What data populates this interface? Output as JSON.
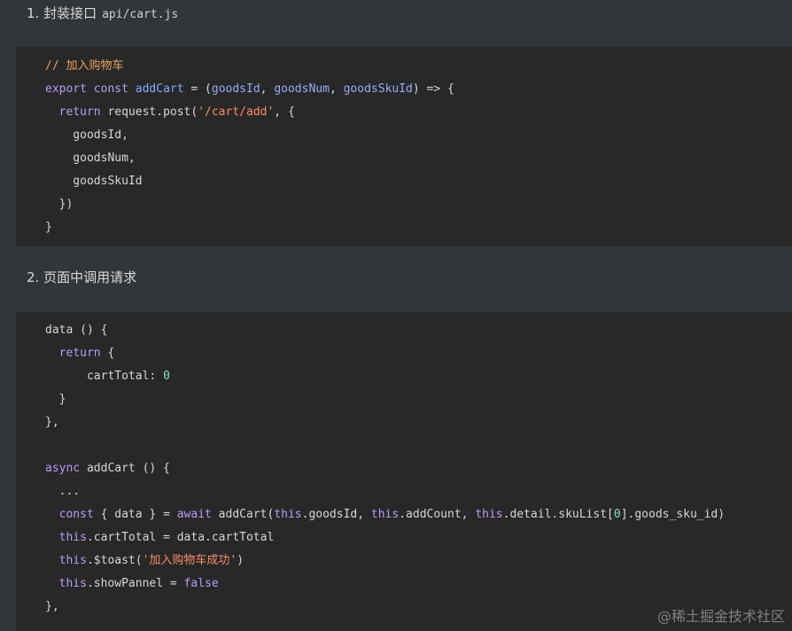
{
  "heading1": {
    "text": "1. 封装接口",
    "code": "api/cart.js"
  },
  "heading2": {
    "text": "2. 页面中调用请求"
  },
  "block1": {
    "lines": [
      {
        "text": "// 加入购物车"
      },
      {
        "text": "export const addCart = (goodsId, goodsNum, goodsSkuId) => {"
      },
      {
        "text": "  return request.post('/cart/add', {"
      },
      {
        "text": "    goodsId,"
      },
      {
        "text": "    goodsNum,"
      },
      {
        "text": "    goodsSkuId"
      },
      {
        "text": "  })"
      },
      {
        "text": "}"
      }
    ]
  },
  "block2": {
    "lines": [
      {
        "text": "data () {"
      },
      {
        "text": "  return {"
      },
      {
        "text": "      cartTotal: 0"
      },
      {
        "text": "  }"
      },
      {
        "text": "},"
      },
      {
        "text": ""
      },
      {
        "text": "async addCart () {"
      },
      {
        "text": "  ..."
      },
      {
        "text": "  const { data } = await addCart(this.goodsId, this.addCount, this.detail.skuList[0].goods_sku_id)"
      },
      {
        "text": "  this.cartTotal = data.cartTotal"
      },
      {
        "text": "  this.$toast('加入购物车成功')"
      },
      {
        "text": "  this.showPannel = false"
      },
      {
        "text": "},"
      }
    ]
  },
  "watermark": "@稀土掘金技术社区",
  "colors": {
    "background": "#333639",
    "code_background": "#282828",
    "keyword": "#b99cf0",
    "function": "#82aaff",
    "string": "#f78c6c",
    "comment": "#e5a263",
    "number": "#89ddba"
  }
}
